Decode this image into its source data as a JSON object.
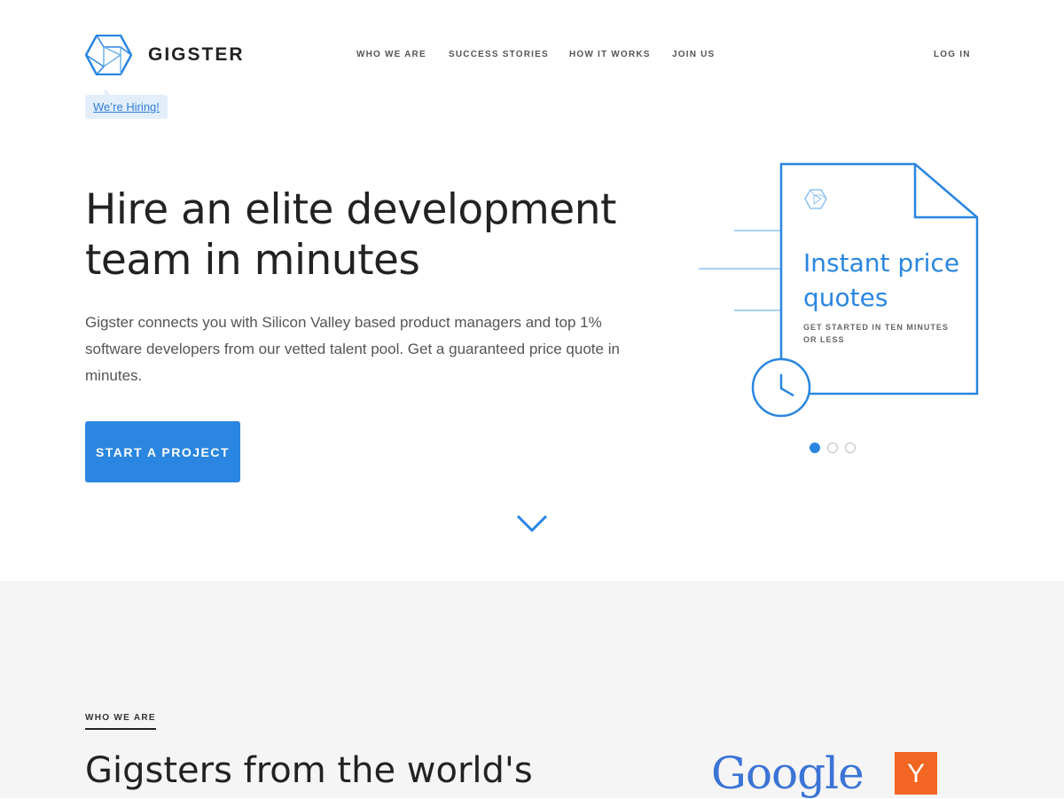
{
  "brand": {
    "name": "GIGSTER",
    "accent": "#2a86e0"
  },
  "nav": {
    "items": [
      "WHO WE ARE",
      "SUCCESS STORIES",
      "HOW IT WORKS",
      "JOIN US"
    ],
    "login": "LOG IN"
  },
  "hiring_badge": "We’re Hiring!",
  "hero": {
    "title": "Hire an elite development team in minutes",
    "description": "Gigster connects you with Silicon Valley based product managers and top 1% software developers from our vetted talent pool. Get a guaranteed price quote in minutes.",
    "cta": "START A PROJECT"
  },
  "carousel": {
    "slide_title": "Instant price quotes",
    "slide_subtitle": "GET STARTED IN TEN MINUTES OR LESS",
    "active_index": 0,
    "count": 3
  },
  "who_we_are": {
    "label": "WHO WE ARE",
    "title": "Gigsters from the world's",
    "logos": {
      "google": "Google",
      "ycombinator": "Y"
    }
  }
}
